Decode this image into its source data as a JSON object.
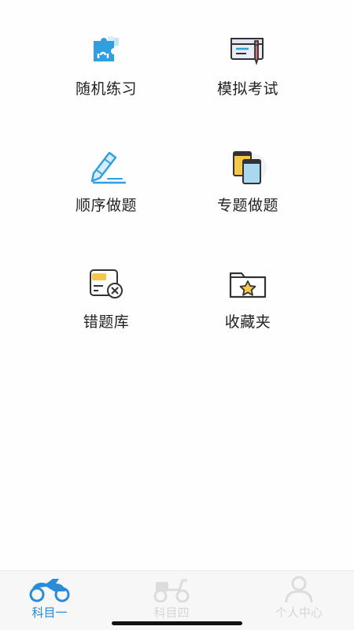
{
  "menu": {
    "items": [
      {
        "label": "随机练习",
        "icon": "puzzle-icon"
      },
      {
        "label": "模拟考试",
        "icon": "exam-card-pen-icon"
      },
      {
        "label": "顺序做题",
        "icon": "pencil-icon"
      },
      {
        "label": "专题做题",
        "icon": "books-icon"
      },
      {
        "label": "错题库",
        "icon": "wrong-card-icon"
      },
      {
        "label": "收藏夹",
        "icon": "star-folder-icon"
      }
    ]
  },
  "tabbar": {
    "tabs": [
      {
        "label": "科目一",
        "icon": "motorcycle-icon",
        "active": true
      },
      {
        "label": "科目四",
        "icon": "scooter-icon",
        "active": false
      },
      {
        "label": "个人中心",
        "icon": "user-icon",
        "active": false
      }
    ]
  },
  "colors": {
    "accent": "#2a8bd8",
    "icon_blue": "#3aa3dd",
    "icon_yellow": "#f5c84a",
    "tab_inactive": "#d6d6d6"
  }
}
